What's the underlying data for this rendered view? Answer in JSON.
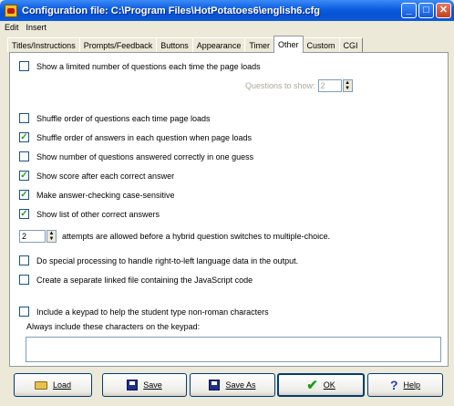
{
  "window": {
    "title": "Configuration file: C:\\Program Files\\HotPotatoes6\\english6.cfg"
  },
  "menu": [
    "Edit",
    "Insert"
  ],
  "tabs": [
    "Titles/Instructions",
    "Prompts/Feedback",
    "Buttons",
    "Appearance",
    "Timer",
    "Other",
    "Custom",
    "CGI"
  ],
  "active_tab": "Other",
  "options": {
    "limited": {
      "label": "Show a limited number of questions each time the page loads",
      "checked": false
    },
    "questions_to_show": {
      "label": "Questions to show:",
      "value": "2"
    },
    "shuffle_questions": {
      "label": "Shuffle order of questions each time page loads",
      "checked": false
    },
    "shuffle_answers": {
      "label": "Shuffle order of answers in each question when page loads",
      "checked": true
    },
    "show_num_correct": {
      "label": "Show number of questions answered correctly in one guess",
      "checked": false
    },
    "show_score": {
      "label": "Show score after each correct answer",
      "checked": true
    },
    "case_sensitive": {
      "label": "Make answer-checking case-sensitive",
      "checked": true
    },
    "other_correct": {
      "label": "Show list of other correct answers",
      "checked": true
    },
    "attempts": {
      "value": "2",
      "label": "attempts are allowed before a hybrid question switches to multiple-choice."
    },
    "rtl": {
      "label": "Do special processing to handle right-to-left language data in the output.",
      "checked": false
    },
    "linked_js": {
      "label": "Create a separate linked file containing the JavaScript code",
      "checked": false
    },
    "keypad": {
      "label": "Include a keypad to help the student type non-roman characters",
      "checked": false
    },
    "keypad_chars": {
      "label": "Always include these characters on the keypad:",
      "value": ""
    }
  },
  "buttons": {
    "load": "Load",
    "save": "Save",
    "save_as": "Save As",
    "ok": "OK",
    "help": "Help"
  }
}
